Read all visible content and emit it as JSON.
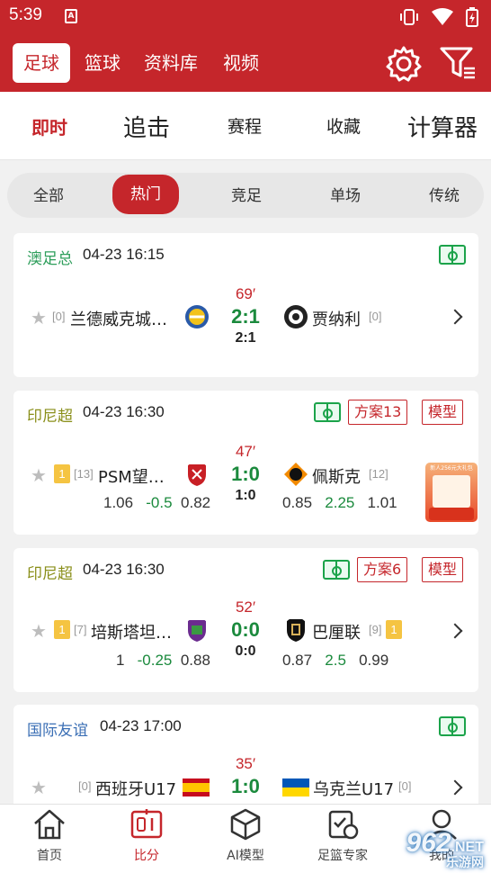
{
  "status_bar": {
    "time": "5:39",
    "notif_letter": "A"
  },
  "header": {
    "sport_tabs": [
      "足球",
      "篮球",
      "资料库",
      "视频"
    ],
    "active_sport": "足球"
  },
  "main_tabs": [
    "即时",
    "追击",
    "赛程",
    "收藏",
    "计算器"
  ],
  "filters": [
    "全部",
    "热门",
    "竞足",
    "单场",
    "传统"
  ],
  "matches": [
    {
      "league": "澳足总",
      "league_color": "#2e9e5b",
      "time": "04-23 16:15",
      "home": "兰德威克城…",
      "home_rank": "[0]",
      "away": "贾纳利",
      "away_rank": "[0]",
      "minute": "69′",
      "score": "2:1",
      "half": "2:1"
    },
    {
      "league": "印尼超",
      "league_color": "#8a8f1a",
      "time": "04-23 16:30",
      "home": "PSM望…",
      "home_rank": "[13]",
      "home_tag": "1",
      "away": "佩斯克",
      "away_rank": "[12]",
      "minute": "47′",
      "score": "1:0",
      "half": "1:0",
      "odds_home": [
        "1.06",
        "-0.5",
        "0.82"
      ],
      "odds_away": [
        "0.85",
        "2.25",
        "1.01"
      ],
      "tags": [
        "方案13",
        "模型"
      ]
    },
    {
      "league": "印尼超",
      "league_color": "#8a8f1a",
      "time": "04-23 16:30",
      "home": "培斯塔坦…",
      "home_rank": "[7]",
      "home_tag": "1",
      "away": "巴厘联",
      "away_rank": "[9]",
      "away_tag": "1",
      "minute": "52′",
      "score": "0:0",
      "half": "0:0",
      "odds_home": [
        "1",
        "-0.25",
        "0.88"
      ],
      "odds_away": [
        "0.87",
        "2.5",
        "0.99"
      ],
      "tags": [
        "方案6",
        "模型"
      ]
    },
    {
      "league": "国际友谊",
      "league_color": "#3b6fb5",
      "time": "04-23 17:00",
      "home": "西班牙U17",
      "home_rank": "[0]",
      "away": "乌克兰U17",
      "away_rank": "[0]",
      "minute": "35′",
      "score": "1:0"
    }
  ],
  "promo_text": "新人256元大礼包",
  "bottom_nav": [
    "首页",
    "比分",
    "AI模型",
    "足篮专家",
    "我的"
  ],
  "active_nav": "比分",
  "watermark": {
    "main": "962",
    "suffix": ".NET",
    "sub": "乐游网"
  },
  "colors": {
    "brand": "#c5262b",
    "score_green": "#1b8a3d"
  }
}
